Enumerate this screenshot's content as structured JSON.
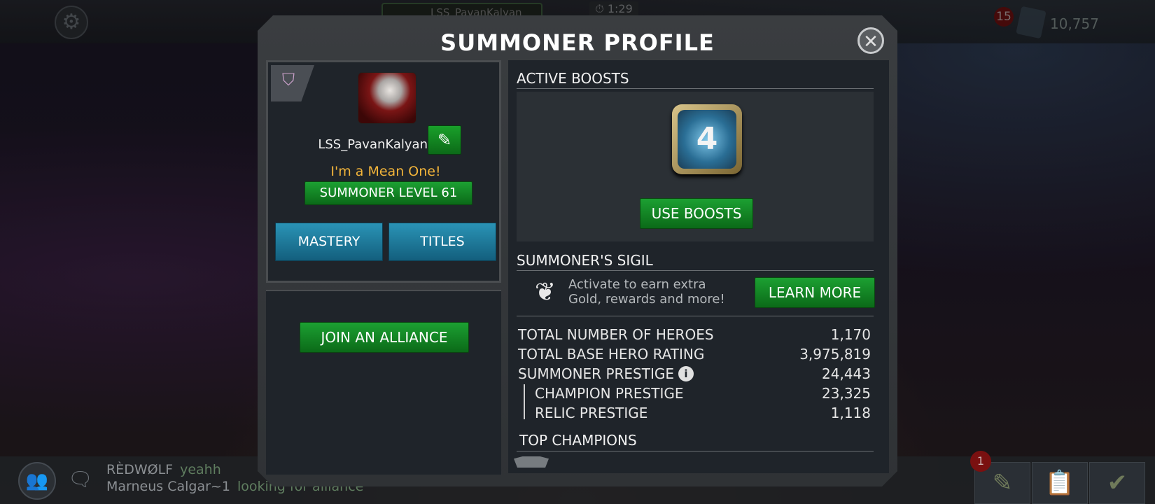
{
  "background": {
    "top_player_tag": "LSS_PavanKalyan",
    "timer": "1:29",
    "notification_count": "15",
    "currency": "10,757",
    "chat": [
      {
        "name": "RÈDWØLF",
        "message": "yeahh"
      },
      {
        "name": "Marneus Calgar~1",
        "message": "looking for alliance"
      }
    ],
    "bottom_badge": "1"
  },
  "modal": {
    "title": "SUMMONER PROFILE",
    "close_icon": "close-icon"
  },
  "profile": {
    "username": "LSS_PavanKalyan",
    "title_text": "I'm a Mean One!",
    "level_label": "SUMMONER LEVEL 61",
    "mastery_label": "MASTERY",
    "titles_label": "TITLES",
    "join_alliance_label": "JOIN AN ALLIANCE"
  },
  "boosts": {
    "section_title": "ACTIVE BOOSTS",
    "boost_icon_text": "4",
    "use_label": "USE BOOSTS"
  },
  "sigil": {
    "section_title": "SUMMONER'S SIGIL",
    "description": "Activate to earn extra Gold, rewards and more!",
    "learn_more_label": "LEARN MORE"
  },
  "stats": [
    {
      "label": "TOTAL NUMBER OF HEROES",
      "value": "1,170"
    },
    {
      "label": "TOTAL BASE HERO RATING",
      "value": "3,975,819"
    },
    {
      "label": "SUMMONER PRESTIGE",
      "value": "24,443"
    },
    {
      "label": "CHAMPION PRESTIGE",
      "value": "23,325"
    },
    {
      "label": "RELIC PRESTIGE",
      "value": "1,118"
    }
  ],
  "top_champions": {
    "section_title": "TOP CHAMPIONS"
  },
  "colors": {
    "accent_green": "#1ca032",
    "accent_blue": "#2a93b6",
    "title_gold": "#f2b43a"
  }
}
